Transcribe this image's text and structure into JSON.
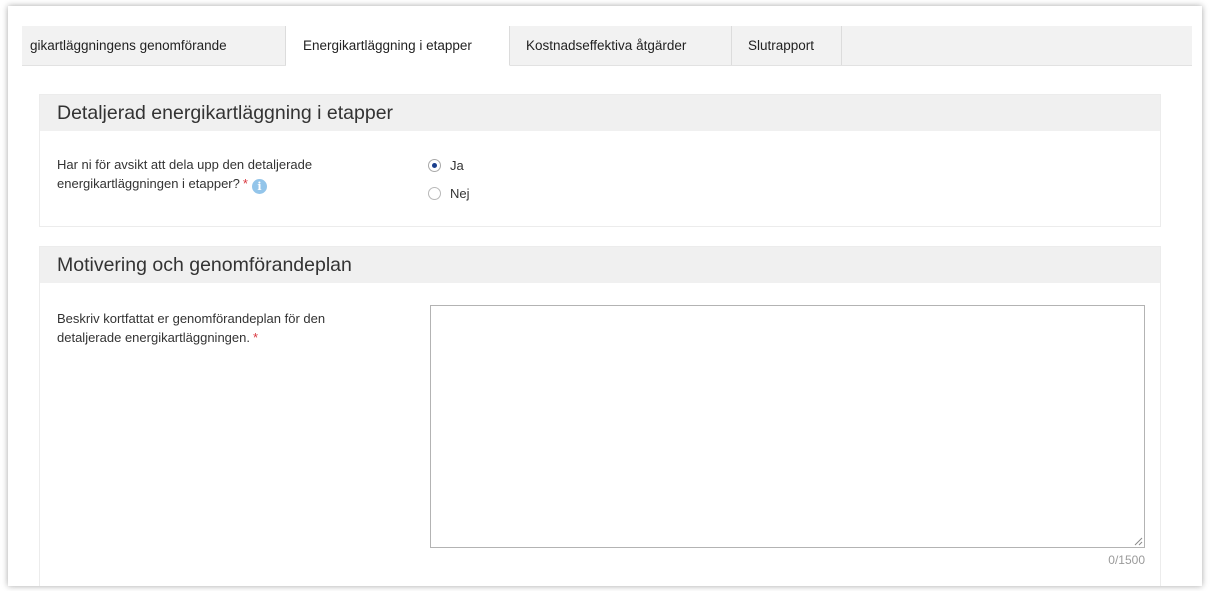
{
  "tabs": [
    {
      "label": "gikartläggningens genomförande",
      "active": false
    },
    {
      "label": "Energikartläggning i etapper",
      "active": true
    },
    {
      "label": "Kostnadseffektiva åtgärder",
      "active": false
    },
    {
      "label": "Slutrapport",
      "active": false
    }
  ],
  "section_etapper": {
    "title": "Detaljerad energikartläggning i etapper",
    "question_line1": "Har ni för avsikt att dela upp den detaljerade",
    "question_line2": "energikartläggningen i etapper?",
    "required_mark": "*",
    "info_icon": "info-icon",
    "options": [
      {
        "label": "Ja",
        "selected": true
      },
      {
        "label": "Nej",
        "selected": false
      }
    ]
  },
  "section_motivering": {
    "title": "Motivering och genomförandeplan",
    "label_line1": "Beskriv kortfattat er genomförandeplan för den",
    "label_line2": "detaljerade energikartläggningen.",
    "required_mark": "*",
    "textarea_value": "",
    "counter": "0/1500"
  },
  "colors": {
    "accent_radio": "#1a3e8c",
    "required": "#d9363e",
    "info": "#93c5ea",
    "header_bg": "#f0f0f0"
  }
}
